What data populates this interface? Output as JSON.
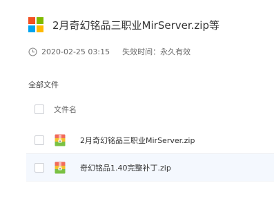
{
  "header": {
    "title": "2月奇幻铭品三职业MirServer.zip等",
    "logo_colors": [
      "#f25022",
      "#7fba00",
      "#00a4ef",
      "#ffb900"
    ]
  },
  "meta": {
    "date": "2020-02-25 03:15",
    "expiry_label": "失效时间：永久有效"
  },
  "breadcrumb": {
    "label": "全部文件"
  },
  "file_list": {
    "column_header": "文件名",
    "files": [
      {
        "name": "2月奇幻铭品三职业MirServer.zip",
        "icon": "zip-archive-icon"
      },
      {
        "name": "奇幻铭品1.40完整补丁.zip",
        "icon": "zip-archive-icon"
      }
    ]
  },
  "colors": {
    "row_highlight": "#f4f8fe",
    "text": "#333333",
    "muted_text": "#666666"
  }
}
